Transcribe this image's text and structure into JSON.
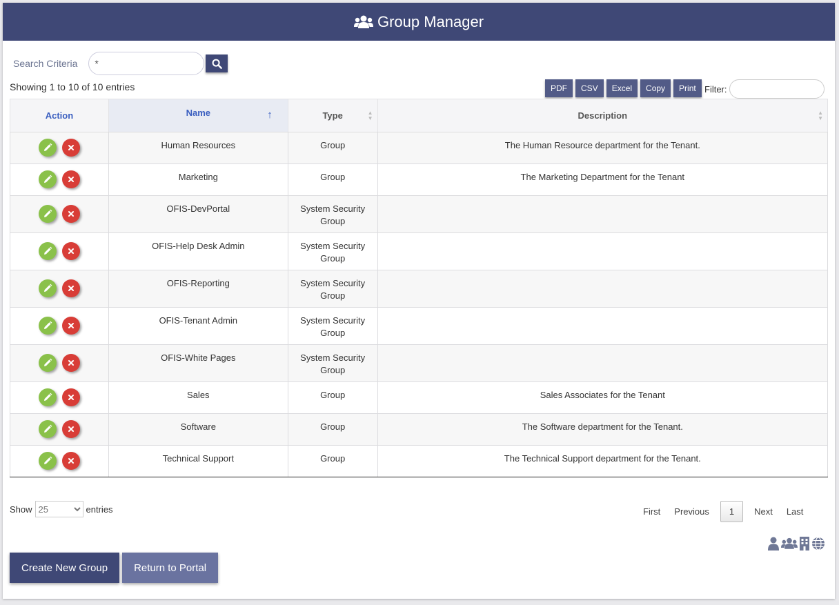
{
  "header": {
    "title": "Group Manager",
    "icon": "users-icon"
  },
  "search": {
    "label": "Search Criteria",
    "value": "*"
  },
  "info": {
    "showing": "Showing 1 to 10 of 10 entries"
  },
  "export": {
    "pdf": "PDF",
    "csv": "CSV",
    "excel": "Excel",
    "copy": "Copy",
    "print": "Print"
  },
  "filter": {
    "label": "Filter:"
  },
  "table": {
    "columns": {
      "action": "Action",
      "name": "Name",
      "type": "Type",
      "description": "Description"
    },
    "sort_indicator": "↑",
    "rows": [
      {
        "name": "Human Resources",
        "type": "Group",
        "description": "The Human Resource department for the Tenant."
      },
      {
        "name": "Marketing",
        "type": "Group",
        "description": "The Marketing Department for the Tenant"
      },
      {
        "name": "OFIS-DevPortal",
        "type_line1": "System Security",
        "type_line2": "Group",
        "description": ""
      },
      {
        "name": "OFIS-Help Desk Admin",
        "type_line1": "System Security",
        "type_line2": "Group",
        "description": ""
      },
      {
        "name": "OFIS-Reporting",
        "type_line1": "System Security",
        "type_line2": "Group",
        "description": ""
      },
      {
        "name": "OFIS-Tenant Admin",
        "type_line1": "System Security",
        "type_line2": "Group",
        "description": ""
      },
      {
        "name": "OFIS-White Pages",
        "type_line1": "System Security",
        "type_line2": "Group",
        "description": ""
      },
      {
        "name": "Sales",
        "type": "Group",
        "description": "Sales Associates for the Tenant"
      },
      {
        "name": "Software",
        "type": "Group",
        "description": "The Software department for the Tenant."
      },
      {
        "name": "Technical Support",
        "type": "Group",
        "description": "The Technical Support department for the Tenant."
      }
    ]
  },
  "length": {
    "show": "Show",
    "value": "25",
    "entries": "entries"
  },
  "pager": {
    "first": "First",
    "previous": "Previous",
    "current": "1",
    "next": "Next",
    "last": "Last"
  },
  "mini_icons": [
    "user-icon",
    "users-icon",
    "building-icon",
    "globe-icon"
  ],
  "buttons": {
    "create": "Create New Group",
    "return": "Return to Portal"
  },
  "colors": {
    "primary": "#3f4876",
    "edit": "#8ac14a",
    "delete": "#d83d37",
    "accent": "#3b5fc0"
  }
}
